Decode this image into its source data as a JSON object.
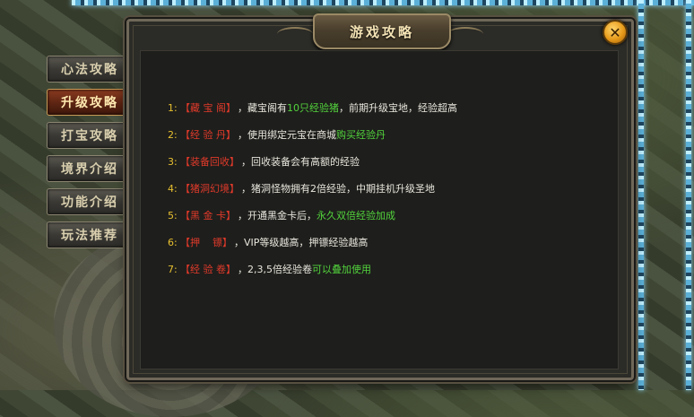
{
  "window": {
    "title": "游戏攻略"
  },
  "colors": {
    "number": "#e8c030",
    "tag": "#e03a2a",
    "text": "#e8e6dc",
    "highlight": "#52d33c",
    "active_tab": "#8b3b20"
  },
  "side_tabs": [
    {
      "label": "心法攻略",
      "active": false
    },
    {
      "label": "升级攻略",
      "active": true
    },
    {
      "label": "打宝攻略",
      "active": false
    },
    {
      "label": "境界介绍",
      "active": false
    },
    {
      "label": "功能介绍",
      "active": false
    },
    {
      "label": "玩法推荐",
      "active": false
    }
  ],
  "items": [
    {
      "num": "1:",
      "tag": "【藏 宝 阁】",
      "text": "，藏宝阁有",
      "hl": "10只经验猪",
      "text2": "，前期升级宝地，经验超高"
    },
    {
      "num": "2:",
      "tag": "【经 验 丹】",
      "text": "，使用绑定元宝在商城",
      "hl": "购买经验丹",
      "text2": ""
    },
    {
      "num": "3:",
      "tag": "【装备回收】",
      "text": "，回收装备会有高额的经验",
      "hl": "",
      "text2": ""
    },
    {
      "num": "4:",
      "tag": "【猪洞幻境】",
      "text": "，猪洞怪物拥有2倍经验，中期挂机升级圣地",
      "hl": "",
      "text2": ""
    },
    {
      "num": "5:",
      "tag": "【黑 金 卡】",
      "text": "，开通黑金卡后，",
      "hl": "永久双倍经验加成",
      "text2": ""
    },
    {
      "num": "6:",
      "tag": "【押    镖】",
      "text": "，VIP等级越高，押镖经验越高",
      "hl": "",
      "text2": ""
    },
    {
      "num": "7:",
      "tag": "【经 验 卷】",
      "text": "，2,3,5倍经验卷",
      "hl": "可以叠加使用",
      "text2": ""
    }
  ],
  "icons": {
    "close": "close-icon"
  }
}
